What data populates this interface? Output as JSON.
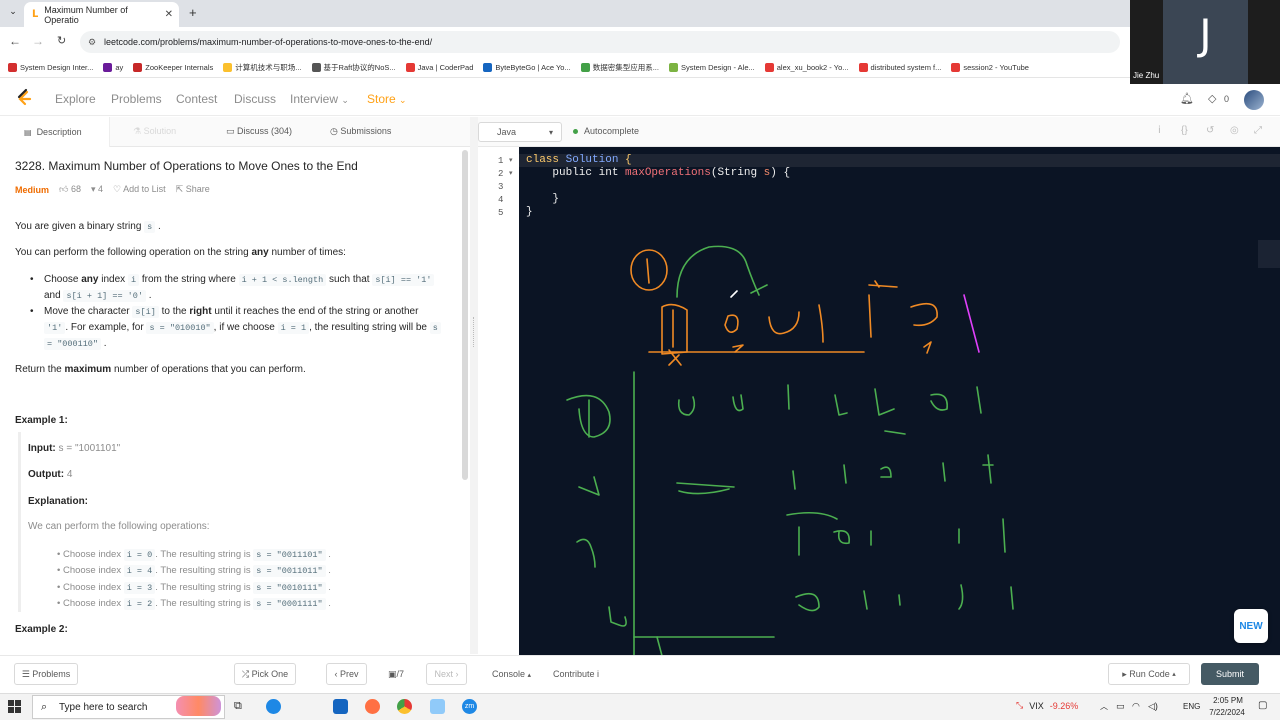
{
  "browser": {
    "tab_title": "Maximum Number of Operatio",
    "url": "leetcode.com/problems/maximum-number-of-operations-to-move-ones-to-the-end/",
    "bookmarks": [
      {
        "label": "System Design Inter...",
        "color": "#d32f2f"
      },
      {
        "label": "ay",
        "color": "#6a1b9a"
      },
      {
        "label": "ZooKeeper Internals",
        "color": "#c62828"
      },
      {
        "label": "计算机技术与职场...",
        "color": "#fbc02d"
      },
      {
        "label": "基于Raft协议的NoS...",
        "color": "#555555"
      },
      {
        "label": "Java | CoderPad",
        "color": "#e53935"
      },
      {
        "label": "ByteByteGo | Ace Yo...",
        "color": "#1565c0"
      },
      {
        "label": "数据密集型应用系...",
        "color": "#43a047"
      },
      {
        "label": "System Design - Ale...",
        "color": "#7cb342"
      },
      {
        "label": "alex_xu_book2 - Yo...",
        "color": "#e53935"
      },
      {
        "label": "distributed system f...",
        "color": "#e53935"
      },
      {
        "label": "session2 - YouTube",
        "color": "#e53935"
      }
    ]
  },
  "webcam": {
    "initial": "J",
    "name": "Jie Zhu"
  },
  "nav": {
    "items": [
      "Explore",
      "Problems",
      "Contest",
      "Discuss",
      "Interview",
      "Store"
    ],
    "notifications": "0",
    "store_color": "#ffa116"
  },
  "left_tabs": [
    "Description",
    "Solution",
    "Discuss (304)",
    "Submissions"
  ],
  "problem": {
    "title": "3228. Maximum Number of Operations to Move Ones to the End",
    "difficulty": "Medium",
    "likes": "68",
    "dislikes": "4",
    "add_to_list": "Add to List",
    "share": "Share",
    "intro": "You are given a binary string",
    "intro_code": "s",
    "ops_pre": "You can perform the following operation on the string",
    "ops_bold": "any",
    "ops_post": "number of times:",
    "bullet1": {
      "t1": "Choose",
      "b1": "any",
      "t2": "index",
      "c1": "i",
      "t3": "from the string where",
      "c2": "i + 1 < s.length",
      "t4": "such that",
      "c3": "s[i] == '1'",
      "t5": "and",
      "c4": "s[i + 1] == '0'",
      "t6": "."
    },
    "bullet2": {
      "t1": "Move the character",
      "c1": "s[i]",
      "t2": "to the",
      "b1": "right",
      "t3": "until it reaches the end of the string or another",
      "c2": "'1'",
      "t4": ". For example, for",
      "c3": "s = \"010010\"",
      "t5": ", if we choose",
      "c4": "i = 1",
      "t6": ", the resulting string will be",
      "c5": "s",
      "c6": "= \"000110\"",
      "t7": "."
    },
    "return_pre": "Return the",
    "return_bold": "maximum",
    "return_post": "number of operations that you can perform.",
    "example1_title": "Example 1:",
    "input_label": "Input:",
    "input_value": "s = \"1001101\"",
    "output_label": "Output:",
    "output_value": "4",
    "explanation_label": "Explanation:",
    "explanation_intro": "We can perform the following operations:",
    "steps": [
      {
        "a": "Choose index",
        "c1": "i = 0",
        "b": ". The resulting string is",
        "c2": "s = \"0011101\"",
        "d": "."
      },
      {
        "a": "Choose index",
        "c1": "i = 4",
        "b": ". The resulting string is",
        "c2": "s = \"0011011\"",
        "d": "."
      },
      {
        "a": "Choose index",
        "c1": "i = 3",
        "b": ". The resulting string is",
        "c2": "s = \"0010111\"",
        "d": "."
      },
      {
        "a": "Choose index",
        "c1": "i = 2",
        "b": ". The resulting string is",
        "c2": "s = \"0001111\"",
        "d": "."
      }
    ],
    "example2_title": "Example 2:"
  },
  "editor": {
    "language": "Java",
    "autocomplete": "Autocomplete",
    "line_numbers": [
      "1",
      "2",
      "3",
      "4",
      "5"
    ],
    "lines": [
      {
        "kw": "class",
        "cls": "Solution",
        "rest": " {"
      },
      {
        "indent": "    ",
        "kw": "public",
        "type": " int ",
        "fn": "maxOperations",
        "p1": "(String ",
        "param": "s",
        "p2": ") {"
      },
      {
        "text": ""
      },
      {
        "text": "    }"
      },
      {
        "text": "}"
      }
    ]
  },
  "bottom": {
    "problems": "Problems",
    "pick_one": "Pick One",
    "prev": "Prev",
    "page": "/7",
    "next": "Next",
    "console": "Console",
    "contribute": "Contribute i",
    "run_code": "Run Code",
    "submit": "Submit",
    "new_badge": "NEW"
  },
  "taskbar": {
    "search_placeholder": "Type here to search",
    "vix_label": "VIX",
    "vix_change": "-9.26%",
    "lang": "ENG",
    "time": "2:05 PM",
    "date": "7/22/2024"
  }
}
